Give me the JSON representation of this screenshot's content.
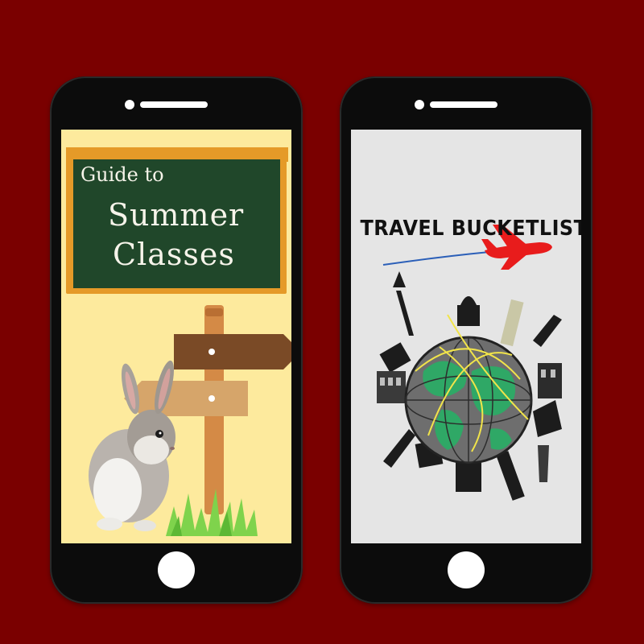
{
  "colors": {
    "background": "#7a0000",
    "phone_body": "#0c0c0c",
    "left_screen": "#fdea9d",
    "right_screen": "#e5e5e5",
    "chalkboard": "#20472a",
    "chalkboard_frame": "#e59a28",
    "sign_dark": "#7a4a26",
    "sign_light": "#d6a56a",
    "post": "#d48a46",
    "grass": "#7fd34c",
    "airplane": "#e81c1c",
    "globe_land": "#2fa866",
    "globe_ocean": "#6d6d6d"
  },
  "left_phone": {
    "chalkboard": {
      "line1": "Guide to",
      "line2": "Summer",
      "line3": "Classes"
    },
    "illustration": [
      "signpost",
      "rabbit",
      "grass"
    ]
  },
  "right_phone": {
    "title": "TRAVEL BUCKETLIST",
    "illustration": [
      "airplane",
      "globe",
      "world-landmarks"
    ]
  },
  "icons": [
    "camera-icon",
    "speaker-icon",
    "home-button-icon",
    "airplane-icon",
    "globe-icon",
    "rabbit-icon",
    "signpost-icon"
  ]
}
